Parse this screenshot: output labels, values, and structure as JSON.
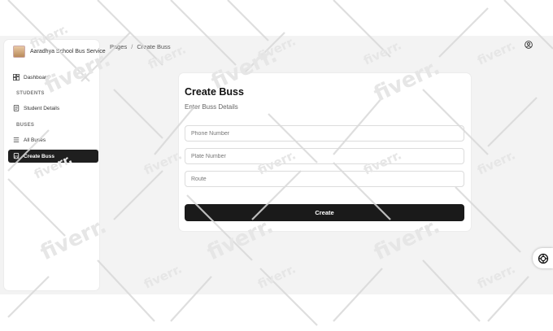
{
  "sidebar": {
    "brand_name": "Aaradhya School Bus Service",
    "items": [
      {
        "label": "Dashboard",
        "icon": "dashboard-icon"
      },
      {
        "label": "Student Details",
        "icon": "student-icon"
      },
      {
        "label": "All Buses",
        "icon": "list-icon"
      },
      {
        "label": "Create Buss",
        "icon": "bus-icon",
        "active": true
      }
    ],
    "sections": [
      "STUDENTS",
      "BUSES"
    ]
  },
  "header": {
    "breadcrumb": [
      "Pages",
      "Create Buss"
    ],
    "breadcrumb_separator": "/"
  },
  "form": {
    "title": "Create Buss",
    "subtitle": "Enter Buss Details",
    "phone_placeholder": "Phone Number",
    "plate_placeholder": "Plate Number",
    "route_placeholder": "Route",
    "submit_label": "Create"
  },
  "watermark": {
    "text": "fiverr."
  },
  "colors": {
    "active_bg": "#1f1f1f",
    "button_bg": "#1a1a1a",
    "app_bg": "#f3f3f3"
  }
}
